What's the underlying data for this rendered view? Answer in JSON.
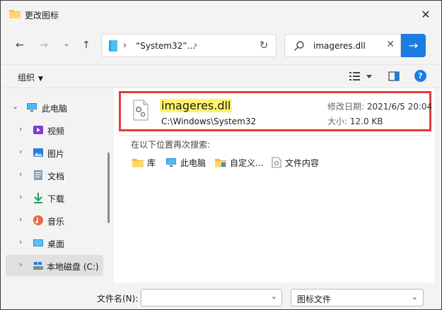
{
  "window": {
    "title": "更改图标",
    "close_icon": "✕"
  },
  "nav": {
    "back_icon": "←",
    "forward_icon": "→",
    "recent_icon": "⌄",
    "up_icon": "↑",
    "address_text": "“System32”...",
    "address_chevron": "›",
    "address_chevron2": "›",
    "refresh_icon": "↻",
    "search_value": "imageres.dll",
    "search_clear": "✕",
    "search_go": "→"
  },
  "command": {
    "organize_label": "组织",
    "organize_caret": "▼",
    "help_label": "?"
  },
  "sidebar": {
    "items": [
      {
        "chevron": "⌄",
        "label": "此电脑"
      },
      {
        "chevron": "›",
        "label": "视频"
      },
      {
        "chevron": "›",
        "label": "图片"
      },
      {
        "chevron": "›",
        "label": "文档"
      },
      {
        "chevron": "›",
        "label": "下载"
      },
      {
        "chevron": "›",
        "label": "音乐"
      },
      {
        "chevron": "›",
        "label": "桌面"
      },
      {
        "chevron": "›",
        "label": "本地磁盘 (C:)"
      }
    ]
  },
  "results": {
    "file_name": "imageres.dll",
    "file_path": "C:\\Windows\\System32",
    "modified_label": "修改日期:",
    "modified_value": "2021/6/5 20:04",
    "size_label": "大小:",
    "size_value": "12.0 KB",
    "search_again_label": "在以下位置再次搜索:",
    "locations": [
      "库",
      "此电脑",
      "自定义...",
      "文件内容"
    ]
  },
  "bottom": {
    "filename_label": "文件名(N):",
    "filename_value": "",
    "filename_caret": "⌄",
    "filetype_value": "图标文件",
    "filetype_caret": "⌄"
  },
  "colors": {
    "accent": "#1c7ce0",
    "highlight_border": "#e33b3b",
    "match_highlight": "#fff36a"
  }
}
